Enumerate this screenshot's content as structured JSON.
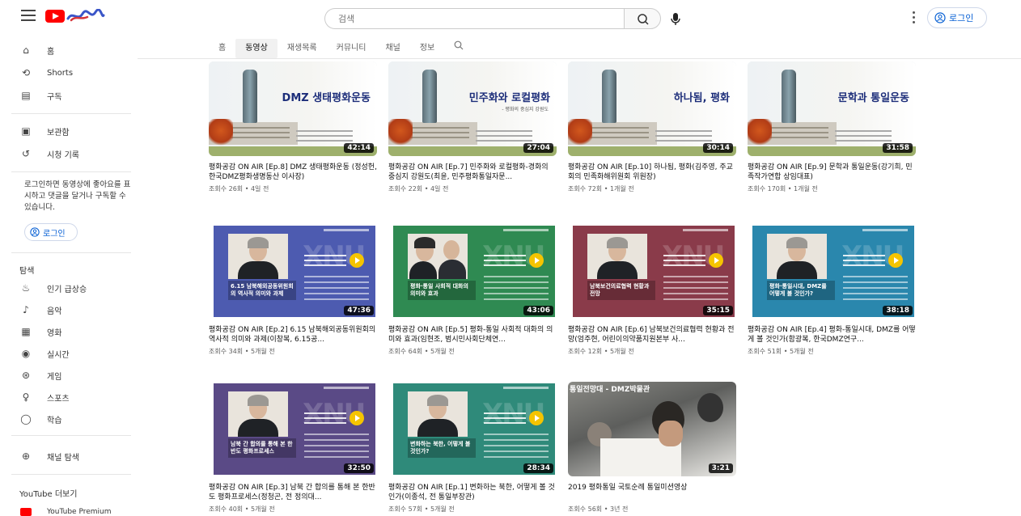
{
  "header": {
    "search_placeholder": "검색",
    "login_label": "로그인"
  },
  "tabs": [
    "홈",
    "동영상",
    "재생목록",
    "커뮤니티",
    "채널",
    "정보"
  ],
  "sidebar": {
    "main": [
      {
        "label": "홈",
        "icon": "home-icon"
      },
      {
        "label": "Shorts",
        "icon": "shorts-icon"
      },
      {
        "label": "구독",
        "icon": "subscriptions-icon"
      }
    ],
    "library": [
      {
        "label": "보관함",
        "icon": "library-icon"
      },
      {
        "label": "시청 기록",
        "icon": "history-icon"
      }
    ],
    "signin_note": "로그인하면 동영상에 좋아요를 표시하고 댓글을 달거나 구독할 수 있습니다.",
    "signin_label": "로그인",
    "explore_heading": "탐색",
    "explore": [
      {
        "label": "인기 급상승",
        "icon": "trending-icon"
      },
      {
        "label": "음악",
        "icon": "music-icon"
      },
      {
        "label": "영화",
        "icon": "movie-icon"
      },
      {
        "label": "실시간",
        "icon": "live-icon"
      },
      {
        "label": "게임",
        "icon": "gaming-icon"
      },
      {
        "label": "스포츠",
        "icon": "sports-icon"
      },
      {
        "label": "학습",
        "icon": "learning-icon"
      }
    ],
    "browse_channels": "채널 탐색",
    "more_heading": "YouTube 더보기",
    "premium": "YouTube Premium"
  },
  "videos": [
    {
      "title": "평화공감 ON AIR [Ep.8] DMZ 생태평화운동 (정성헌, 한국DMZ평화생명동산 이사장)",
      "meta": "조회수 26회 • 4일 전",
      "duration": "42:14",
      "thumb_text": "DMZ 생태평화운동",
      "thumb_sub": "",
      "style": "A"
    },
    {
      "title": "평화공감 ON AIR [Ep.7] 민주화와 로컬평화-경화의 중심지 강원도(최윤, 민주평화통일자문...",
      "meta": "조회수 22회 • 4일 전",
      "duration": "27:04",
      "thumb_text": "민주화와 로컬평화",
      "thumb_sub": "- 평화의 중심지 강원도",
      "style": "A"
    },
    {
      "title": "평화공감 ON AIR [Ep.10] 하나됨, 평화(김주영, 주교회의 민족화해위원회 위원장)",
      "meta": "조회수 72회 • 1개월 전",
      "duration": "30:14",
      "thumb_text": "하나됨, 평화",
      "thumb_sub": "",
      "style": "A"
    },
    {
      "title": "평화공감 ON AIR [Ep.9] 문학과 통일운동(강기희, 민족작가연합 상임대표)",
      "meta": "조회수 170회 • 1개월 전",
      "duration": "31:58",
      "thumb_text": "문학과 통일운동",
      "thumb_sub": "",
      "style": "A"
    },
    {
      "title": "평화공감 ON AIR [Ep.2] 6.15 남북해외공동위원회의 역사적 의미와 과제(이창복, 6.15공...",
      "meta": "조회수 34회 • 5개월 전",
      "duration": "47:36",
      "thumb_text": "6.15 남북해외공동위원회의 역사적 의미와 과제",
      "thumb_sub": "",
      "style": "B",
      "color": "#4d5bb0"
    },
    {
      "title": "평화공감 ON AIR [Ep.5] 평화-통일 사회적 대화의 의미와 효과(임현조, 범시민사회단체연...",
      "meta": "조회수 64회 • 5개월 전",
      "duration": "43:06",
      "thumb_text": "평화·통일 사회적 대화의 의미와 효과",
      "thumb_sub": "",
      "style": "B2",
      "color": "#2f8a52"
    },
    {
      "title": "평화공감 ON AIR [Ep.6] 남북보건의료협력 현황과 전망(엄주현, 어린이의약품지원본부 사...",
      "meta": "조회수 12회 • 5개월 전",
      "duration": "35:15",
      "thumb_text": "남북보건의료협력 현황과 전망",
      "thumb_sub": "",
      "style": "B",
      "color": "#8a3b4a"
    },
    {
      "title": "평화공감 ON AIR [Ep.4] 평화-통일시대, DMZ를 어떻게 볼 것인가(함광복, 한국DMZ연구...",
      "meta": "조회수 51회 • 5개월 전",
      "duration": "38:18",
      "thumb_text": "평화·통일시대, DMZ를 어떻게 볼 것인가?",
      "thumb_sub": "",
      "style": "B",
      "color": "#2a87ad"
    },
    {
      "title": "평화공감 ON AIR [Ep.3] 남북 간 합의를 통해 본 한반도 평화프로세스(정청곤, 전 정의대...",
      "meta": "조회수 40회 • 5개월 전",
      "duration": "32:50",
      "thumb_text": "남북 간 합의를 통해 본 한반도 평화프로세스",
      "thumb_sub": "",
      "style": "B",
      "color": "#5a4a86"
    },
    {
      "title": "평화공감 ON AIR [Ep.1] 변화하는 북한, 어떻게 볼 것인가(이종석, 전 통일부장관)",
      "meta": "조회수 57회 • 5개월 전",
      "duration": "28:34",
      "thumb_text": "변화하는 북한, 어떻게 볼 것인가?",
      "thumb_sub": "",
      "style": "B",
      "color": "#2f8a7a"
    },
    {
      "title": "2019 평화통일 국토순례 통일미션영상",
      "meta": "조회수 56회 • 3년 전",
      "duration": "3:21",
      "thumb_text": "통일전망대 - DMZ박물관",
      "thumb_sub": "",
      "style": "C"
    }
  ]
}
